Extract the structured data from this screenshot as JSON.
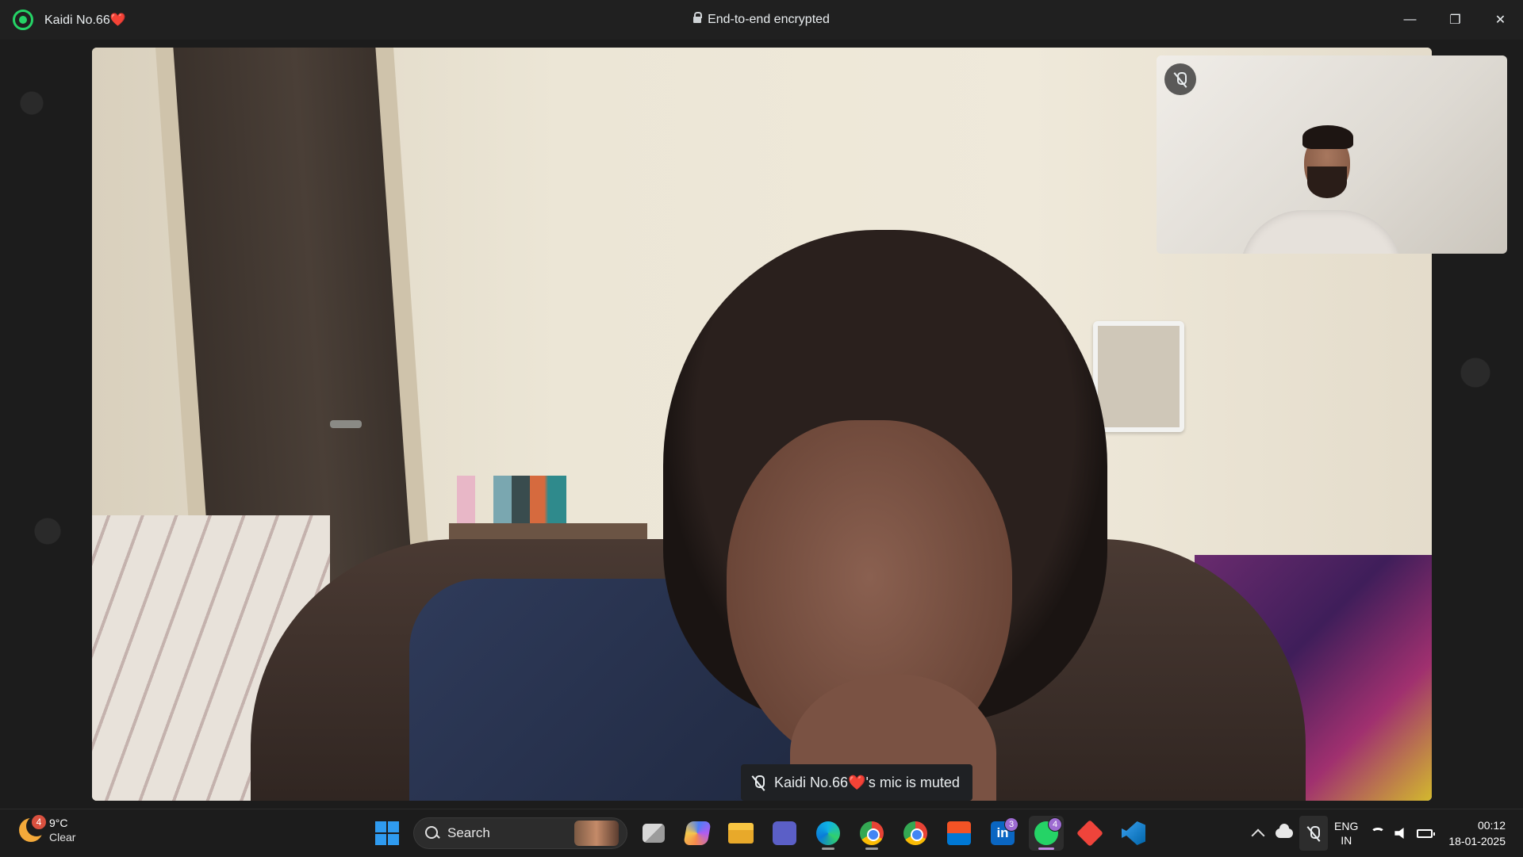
{
  "window": {
    "chat_name": "Kaidi No.66❤️",
    "encryption_label": "End-to-end encrypted",
    "minimize_glyph": "—",
    "maximize_glyph": "❐",
    "close_glyph": "✕"
  },
  "call": {
    "mute_notice": "Kaidi No.66❤️'s mic is muted"
  },
  "taskbar": {
    "weather": {
      "temperature": "9°C",
      "condition": "Clear",
      "badge": "4"
    },
    "search_label": "Search",
    "apps": [
      {
        "name": "start",
        "icon": "windows-logo-icon"
      },
      {
        "name": "task-view",
        "icon": "task-view-icon"
      },
      {
        "name": "copilot",
        "icon": "copilot-icon"
      },
      {
        "name": "file-explorer",
        "icon": "folder-icon"
      },
      {
        "name": "teams",
        "icon": "teams-icon"
      },
      {
        "name": "edge",
        "icon": "edge-icon"
      },
      {
        "name": "chrome-profile-1",
        "icon": "chrome-icon"
      },
      {
        "name": "chrome-profile-2",
        "icon": "chrome-icon"
      },
      {
        "name": "microsoft-store",
        "icon": "store-icon"
      },
      {
        "name": "linkedin",
        "icon": "linkedin-icon",
        "badge": "3",
        "glyph": "in"
      },
      {
        "name": "whatsapp",
        "icon": "whatsapp-icon",
        "badge": "4",
        "active": true
      },
      {
        "name": "anydesk",
        "icon": "anydesk-icon"
      },
      {
        "name": "vscode",
        "icon": "vscode-icon"
      }
    ],
    "tray": {
      "language_primary": "ENG",
      "language_secondary": "IN",
      "time": "00:12",
      "date": "18-01-2025"
    }
  },
  "colors": {
    "whatsapp_green": "#25d366",
    "titlebar_bg": "#202020",
    "taskbar_bg": "#1c1c1c",
    "badge_purple": "#9d6bd1"
  }
}
